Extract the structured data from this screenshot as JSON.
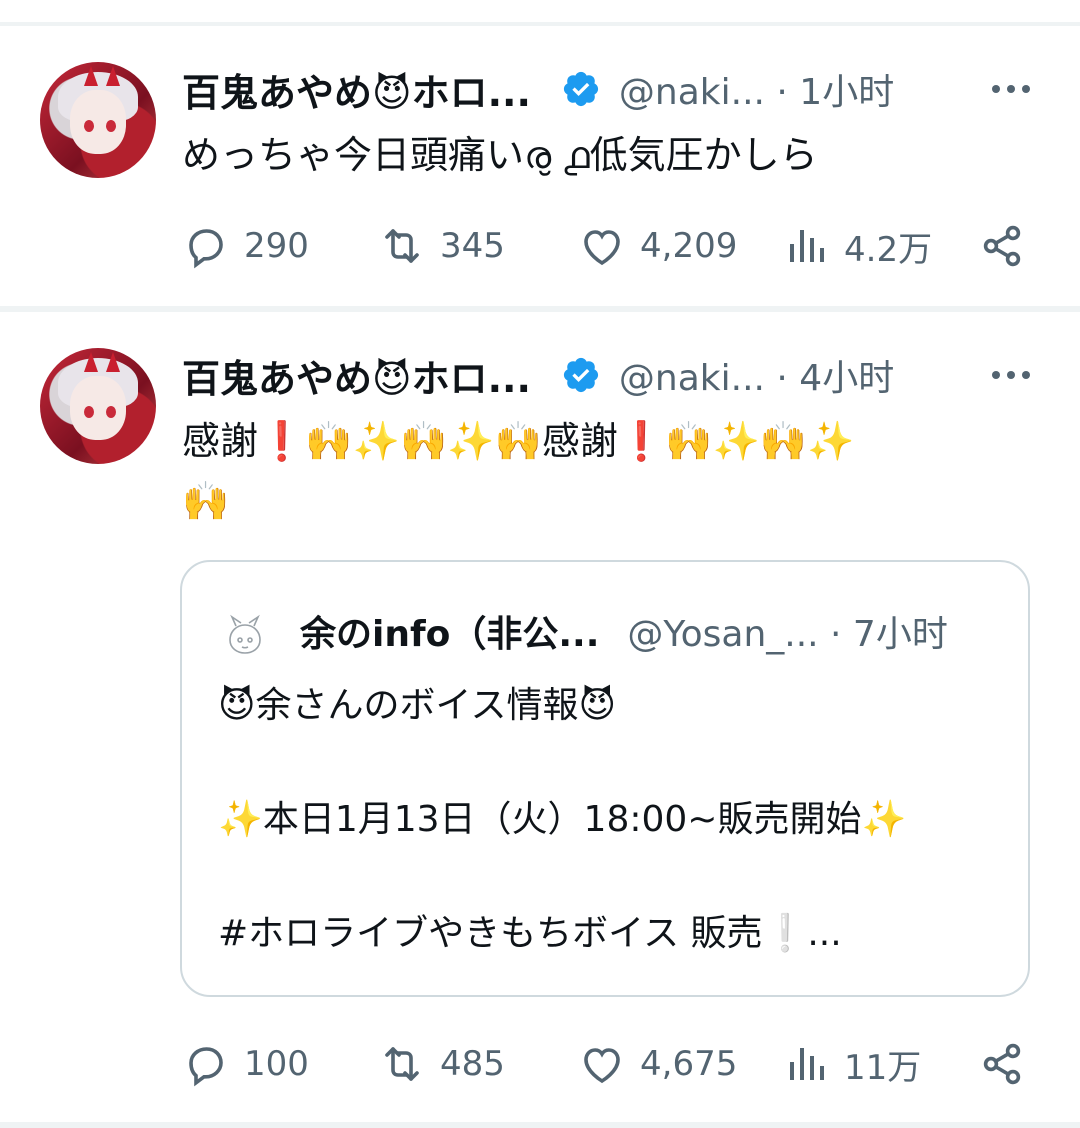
{
  "tweets": [
    {
      "display_name": "百鬼あやめ😈ホロ...",
      "handle_time": "@naki... · 1小时",
      "text": "めっちゃ今日頭痛いര̮ ൧低気圧かしら",
      "stats": {
        "replies": "290",
        "reposts": "345",
        "likes": "4,209",
        "views": "4.2万"
      }
    },
    {
      "display_name": "百鬼あやめ😈ホロ...",
      "handle_time": "@naki... · 4小时",
      "text_line1": "感謝❗️🙌✨🙌✨🙌感謝❗️🙌✨🙌✨",
      "text_line2": "🙌",
      "stats": {
        "replies": "100",
        "reposts": "485",
        "likes": "4,675",
        "views": "11万"
      },
      "quote": {
        "display_name": "余のinfo（非公...",
        "handle_time": "@Yosan_... · 7小时",
        "line1": "😈余さんのボイス情報😈",
        "line2": "✨本日1月13日（火）18:00~販売開始✨",
        "line3": "#ホロライブやきもちボイス 販売❕..."
      }
    }
  ],
  "icons": [
    "verified-badge-icon",
    "more-icon",
    "reply-icon",
    "repost-icon",
    "like-icon",
    "views-icon",
    "share-icon"
  ],
  "colors": {
    "text": "#0f1419",
    "secondary": "#536471",
    "verified": "#1d9bf0",
    "divider": "#eff3f4",
    "quote_border": "#cfd9de"
  }
}
